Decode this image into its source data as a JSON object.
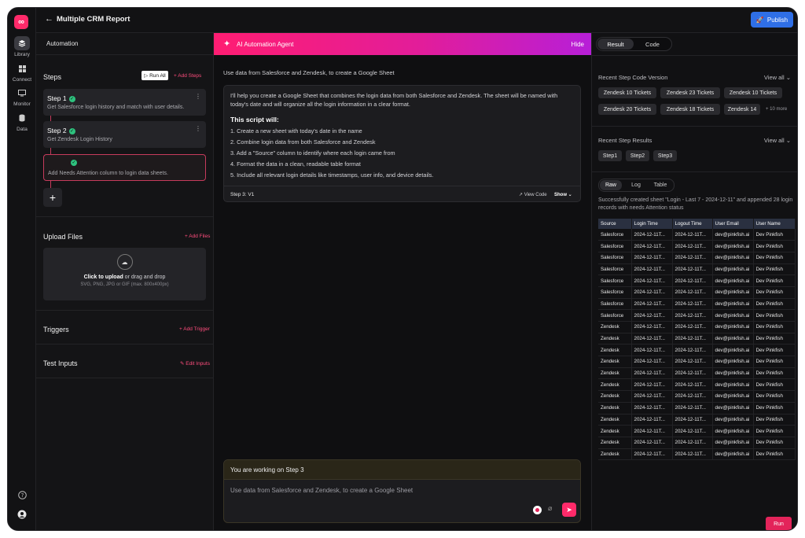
{
  "app": {
    "brand_color": "#ff2a6a",
    "logo_icon": "infinity-icon",
    "logo_glyph": "∞"
  },
  "rail": {
    "items": [
      {
        "label": "Library",
        "icon": "library-icon",
        "active": true
      },
      {
        "label": "Connect",
        "icon": "grid-icon",
        "active": false
      },
      {
        "label": "Monitor",
        "icon": "monitor-icon",
        "active": false
      },
      {
        "label": "Data",
        "icon": "database-icon",
        "active": false
      }
    ],
    "help_icon": "help-icon",
    "user_icon": "user-icon"
  },
  "header": {
    "title": "Multiple CRM Report",
    "publish_label": "Publish"
  },
  "left": {
    "panel_title": "Automation",
    "steps_title": "Steps",
    "run_all_label": "▷ Run All",
    "add_steps_label": "+ Add Steps",
    "steps": [
      {
        "title": "Step 1",
        "desc": "Get Salesforce login history and match with user details.",
        "status": "done"
      },
      {
        "title": "Step 2",
        "desc": "Get Zendesk Login History",
        "status": "done"
      },
      {
        "title": "",
        "desc": "Add Needs Attention column to login data sheets.",
        "status": "attention"
      }
    ],
    "upload_title": "Upload Files",
    "add_files_label": "+ Add Files",
    "upload_cta": "Click to upload",
    "upload_alt": " or drag and drop",
    "upload_hint": "SVG, PNG, JPG or GIF (max. 800x400px)",
    "triggers_title": "Triggers",
    "add_trigger_label": "+ Add Trigger",
    "test_inputs_title": "Test Inputs",
    "edit_inputs_label": "Edit Inputs"
  },
  "agent": {
    "title": "AI Automation Agent",
    "hide_label": "Hide",
    "user_prompt": "Use data from Salesforce and Zendesk, to create a Google Sheet",
    "response_intro": "I'll help you create a Google Sheet that combines the login data from both Salesforce and Zendesk. The sheet will be named with today's date and will organize all the login information in a clear format.",
    "script_heading": "This script will:",
    "script_items": [
      "1. Create a new sheet with today's date in the name",
      "2. Combine login data from both Salesforce and Zendesk",
      "3. Add a \"Source\" column to identify where each login came from",
      "4. Format the data in a clean, readable table format",
      "5. Include all relevant login details like timestamps, user info, and device details."
    ],
    "step_version": "Step 3: V1",
    "view_code_label": "View Code",
    "show_label": "Show",
    "context_label": "You are working on Step 3",
    "input_value": "Use data from Salesforce and Zendesk, to create a Google Sheet"
  },
  "right": {
    "tabs": [
      "Result",
      "Code"
    ],
    "active_tab": "Result",
    "recent_versions_title": "Recent Step Code Version",
    "view_all_label": "View all",
    "version_chips": [
      "Zendesk 10 Tickets",
      "Zendesk 23 Tickets",
      "Zendesk 10 Tickets",
      "Zendesk 20 Tickets",
      "Zendesk 18 Tickets",
      "Zendesk 14"
    ],
    "more_label": "+ 10 more",
    "recent_results_title": "Recent Step Results",
    "result_chips": [
      "Step1",
      "Step2",
      "Step3"
    ],
    "result_tabs": [
      "Raw",
      "Log",
      "Table"
    ],
    "active_result_tab": "Raw",
    "success_message": "Successfully created sheet \"Login - Last 7 - 2024-12-11\" and appended 28 login records with needs Attention status",
    "table": {
      "columns": [
        "Source",
        "Login Time",
        "Logout Time",
        "User Email",
        "User Name"
      ],
      "rows": [
        [
          "Salesforce",
          "2024-12-11T...",
          "2024-12-11T...",
          "dev@pinkfish.ai",
          "Dev Pinkfish"
        ],
        [
          "Salesforce",
          "2024-12-11T...",
          "2024-12-11T...",
          "dev@pinkfish.ai",
          "Dev Pinkfish"
        ],
        [
          "Salesforce",
          "2024-12-11T...",
          "2024-12-11T...",
          "dev@pinkfish.ai",
          "Dev Pinkfish"
        ],
        [
          "Salesforce",
          "2024-12-11T...",
          "2024-12-11T...",
          "dev@pinkfish.ai",
          "Dev Pinkfish"
        ],
        [
          "Salesforce",
          "2024-12-11T...",
          "2024-12-11T...",
          "dev@pinkfish.ai",
          "Dev Pinkfish"
        ],
        [
          "Salesforce",
          "2024-12-11T...",
          "2024-12-11T...",
          "dev@pinkfish.ai",
          "Dev Pinkfish"
        ],
        [
          "Salesforce",
          "2024-12-11T...",
          "2024-12-11T...",
          "dev@pinkfish.ai",
          "Dev Pinkfish"
        ],
        [
          "Salesforce",
          "2024-12-11T...",
          "2024-12-11T...",
          "dev@pinkfish.ai",
          "Dev Pinkfish"
        ],
        [
          "Zendesk",
          "2024-12-11T...",
          "2024-12-11T...",
          "dev@pinkfish.ai",
          "Dev Pinkfish"
        ],
        [
          "Zendesk",
          "2024-12-11T...",
          "2024-12-11T...",
          "dev@pinkfish.ai",
          "Dev Pinkfish"
        ],
        [
          "Zendesk",
          "2024-12-11T...",
          "2024-12-11T...",
          "dev@pinkfish.ai",
          "Dev Pinkfish"
        ],
        [
          "Zendesk",
          "2024-12-11T...",
          "2024-12-11T...",
          "dev@pinkfish.ai",
          "Dev Pinkfish"
        ],
        [
          "Zendesk",
          "2024-12-11T...",
          "2024-12-11T...",
          "dev@pinkfish.ai",
          "Dev Pinkfish"
        ],
        [
          "Zendesk",
          "2024-12-11T...",
          "2024-12-11T...",
          "dev@pinkfish.ai",
          "Dev Pinkfish"
        ],
        [
          "Zendesk",
          "2024-12-11T...",
          "2024-12-11T...",
          "dev@pinkfish.ai",
          "Dev Pinkfish"
        ],
        [
          "Zendesk",
          "2024-12-11T...",
          "2024-12-11T...",
          "dev@pinkfish.ai",
          "Dev Pinkfish"
        ],
        [
          "Zendesk",
          "2024-12-11T...",
          "2024-12-11T...",
          "dev@pinkfish.ai",
          "Dev Pinkfish"
        ],
        [
          "Zendesk",
          "2024-12-11T...",
          "2024-12-11T...",
          "dev@pinkfish.ai",
          "Dev Pinkfish"
        ],
        [
          "Zendesk",
          "2024-12-11T...",
          "2024-12-11T...",
          "dev@pinkfish.ai",
          "Dev Pinkfish"
        ],
        [
          "Zendesk",
          "2024-12-11T...",
          "2024-12-11T...",
          "dev@pinkfish.ai",
          "Dev Pinkfish"
        ]
      ]
    },
    "run_label": "Run"
  }
}
